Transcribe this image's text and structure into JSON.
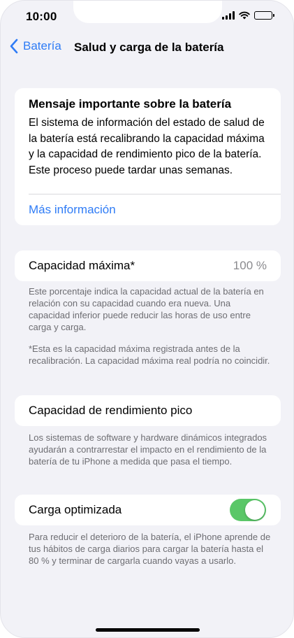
{
  "status_bar": {
    "time": "10:00",
    "icons": [
      "signal-icon",
      "wifi-icon",
      "battery-icon"
    ]
  },
  "nav": {
    "back_label": "Batería",
    "title": "Salud y carga de la batería"
  },
  "message_card": {
    "title": "Mensaje importante sobre la batería",
    "body": "El sistema de información del estado de salud de la batería está recalibrando la capacidad máxima y la capacidad de rendimiento pico de la batería. Este proceso puede tardar unas semanas.",
    "link": "Más información"
  },
  "max_capacity": {
    "label": "Capacidad máxima*",
    "value": "100 %",
    "footnote_1": "Este porcentaje indica la capacidad actual de la batería en relación con su capacidad cuando era nueva. Una capacidad inferior puede reducir las horas de uso entre carga y carga.",
    "footnote_2": "*Esta es la capacidad máxima registrada antes de la recalibración. La capacidad máxima real podría no coincidir."
  },
  "peak_performance": {
    "label": "Capacidad de rendimiento pico",
    "footnote": "Los sistemas de software y hardware dinámicos integrados ayudarán a contrarrestar el impacto en el rendimiento de la batería de tu iPhone a medida que pasa el tiempo."
  },
  "optimized_charging": {
    "label": "Carga optimizada",
    "enabled": true,
    "footnote": "Para reducir el deterioro de la batería, el iPhone aprende de tus hábitos de carga diarios para cargar la batería hasta el 80 % y terminar de cargarla cuando vayas a usarlo."
  },
  "colors": {
    "accent": "#2f7cf6",
    "toggle_on": "#5ac768",
    "background": "#f2f2f7"
  }
}
